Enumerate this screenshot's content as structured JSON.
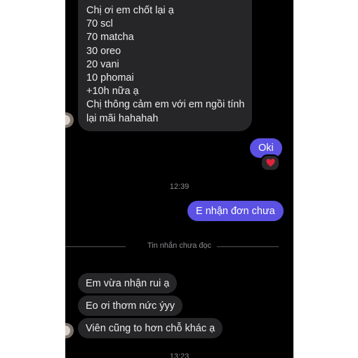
{
  "conversation": {
    "messages": [
      {
        "dir": "in",
        "lines": [
          "Chị ơi em chốt lại ạ",
          "70 scl",
          "70 matcha",
          "30 oreo",
          "20 vani",
          "10 phomai",
          "+10h nữa ạ",
          "Chị thông cảm em với em ngồi tính",
          "lại mãi hahahah"
        ]
      },
      {
        "dir": "out",
        "text": "Oki",
        "reaction": "heart"
      },
      {
        "dir": "out",
        "text": "E nhận đơn chưa"
      },
      {
        "dir": "in",
        "text": "Em vừa nhận rui ạ"
      },
      {
        "dir": "in",
        "text": "Eo ơi thơm nức ýyy"
      },
      {
        "dir": "in",
        "text": "Viên cũng to hơn chỗ khác ạ"
      }
    ],
    "timestamps": [
      "12:39",
      "13:23"
    ],
    "unread_divider": "Tin nhắn chưa đọc",
    "colors": {
      "outgoing": "#5b51e3",
      "incoming": "#262628",
      "background": "#000000",
      "reaction": "#e0243b"
    }
  }
}
